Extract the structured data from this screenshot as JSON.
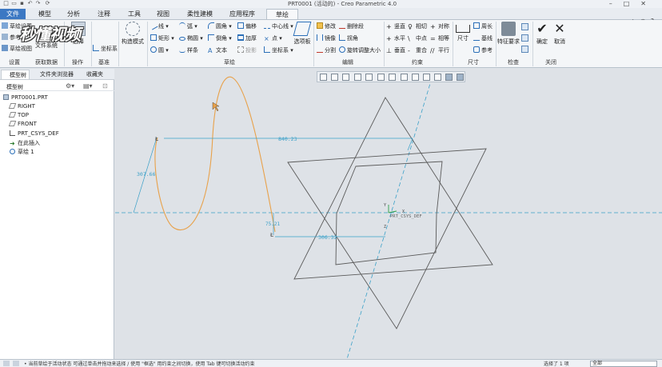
{
  "window": {
    "title": "PRT0001 (活动的) - Creo Parametric 4.0"
  },
  "tabs": [
    {
      "label": "文件"
    },
    {
      "label": "模型"
    },
    {
      "label": "分析"
    },
    {
      "label": "注释"
    },
    {
      "label": "工具"
    },
    {
      "label": "视图"
    },
    {
      "label": "柔性建模"
    },
    {
      "label": "应用程序"
    },
    {
      "label": "草绘"
    }
  ],
  "watermark": "秒懂视频",
  "ribbon": {
    "setup": {
      "items": [
        "草绘设置",
        "参考",
        "草绘视图"
      ],
      "file_system": "文件系统",
      "label": "设置"
    },
    "get_data": {
      "label": "获取数据"
    },
    "operations": {
      "select": "选择",
      "label": "操作"
    },
    "datum": {
      "csys": "坐标系",
      "label": "基准"
    },
    "construction": {
      "label": "构造模式"
    },
    "sketch": {
      "label": "草绘",
      "col1": [
        "线",
        "矩形",
        "圆"
      ],
      "col2": [
        "弧",
        "椭圆",
        "样条"
      ],
      "col3": [
        "圆角",
        "倒角",
        "文本"
      ],
      "col4": [
        "偏移",
        "加厚",
        "投影"
      ],
      "col5": [
        "中心线",
        "点",
        "坐标系"
      ],
      "palette": "选项板"
    },
    "editing": {
      "label": "编辑",
      "col1": [
        "修改",
        "镜像",
        "分割"
      ],
      "col2": [
        "删除段",
        "拐角",
        "旋转调整大小"
      ]
    },
    "constrain": {
      "label": "约束",
      "col1": [
        "竖直",
        "水平",
        "垂直"
      ],
      "col2": [
        "相切",
        "中点",
        "重合"
      ],
      "col3": [
        "对称",
        "相等",
        "平行"
      ]
    },
    "dimension": {
      "label": "尺寸",
      "main": "尺寸",
      "items": [
        "周长",
        "基线",
        "参考"
      ]
    },
    "inspect": {
      "label": "检查",
      "feature_req": "特征要求"
    },
    "close": {
      "label": "关闭",
      "ok": "确定",
      "cancel": "取消"
    }
  },
  "sidebar": {
    "tabs": [
      "模型树",
      "文件夹浏览器",
      "收藏夹"
    ],
    "tree_header": "模型树",
    "items": [
      "PRT0001.PRT",
      "RIGHT",
      "TOP",
      "FRONT",
      "PRT_CSYS_DEF",
      "在此插入",
      "草绘 1"
    ]
  },
  "sketch": {
    "dims": {
      "horizontal": "840.23",
      "vertical": "307.66",
      "small": "75.21",
      "offset": "306.32"
    },
    "csys_label": "PRT_CSYS_DEF",
    "axis_x": "X",
    "axis_y": "Y",
    "axis_z": "Z"
  },
  "statusbar": {
    "message": "• 当前草绘于活动状态 可通过单击并拖动来选择 / 使用 \"框选\" 用约束之间切换，使用 Tab 键可切换活动约束",
    "selection": "选择了 1 项",
    "filter": "全部"
  },
  "colors": {
    "accent": "#3c78c3",
    "sketch_curve": "#e8a14a",
    "dimension": "#3aa0c8",
    "geometry": "#555555"
  }
}
